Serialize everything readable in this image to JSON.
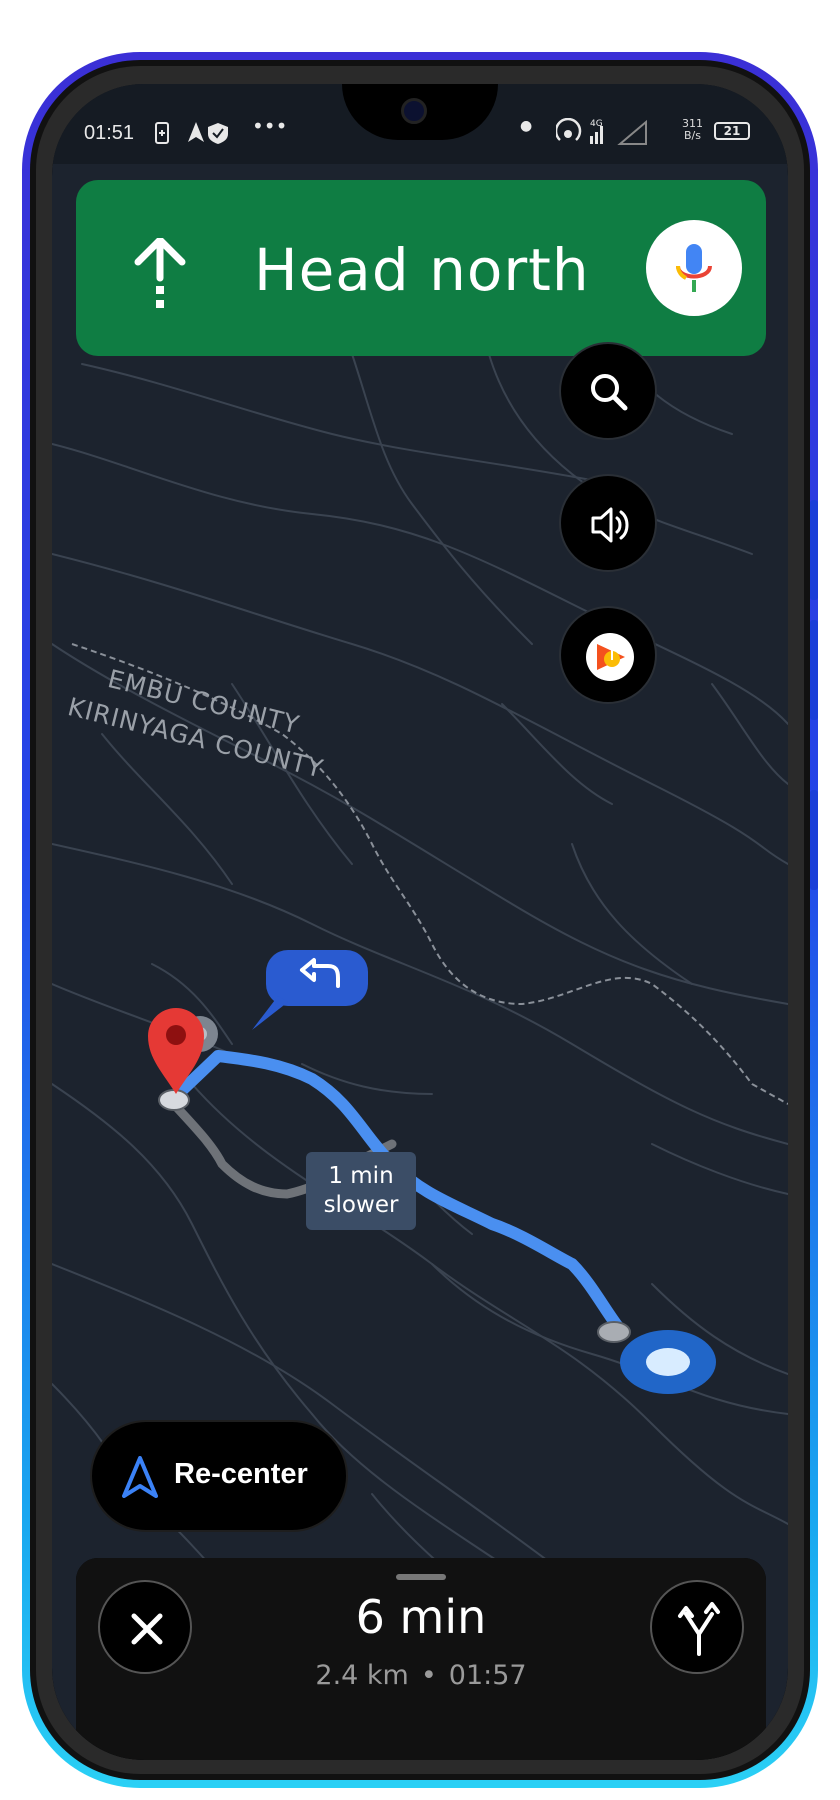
{
  "status_bar": {
    "time": "01:51",
    "network_label": "4G",
    "net_speed_value": "311",
    "net_speed_unit": "B/s",
    "battery_level": "21"
  },
  "navigation": {
    "instruction": "Head north",
    "direction_icon": "arrow-up-icon"
  },
  "map": {
    "labels": [
      "EMBU COUNTY",
      "KIRINYAGA COUNTY"
    ],
    "alt_route_label_line1": "1 min",
    "alt_route_label_line2": "slower",
    "route_color": "#4a8ff0",
    "alt_route_color": "#6e7278"
  },
  "controls": {
    "search_icon": "search-icon",
    "sound_icon": "volume-icon",
    "music_icon": "music-icon",
    "recenter_label": "Re-center"
  },
  "trip": {
    "eta_duration": "6 min",
    "distance": "2.4 km",
    "separator": "•",
    "arrival_time": "01:57"
  },
  "colors": {
    "banner_green": "#0f7d43",
    "map_background": "#1c232e"
  }
}
